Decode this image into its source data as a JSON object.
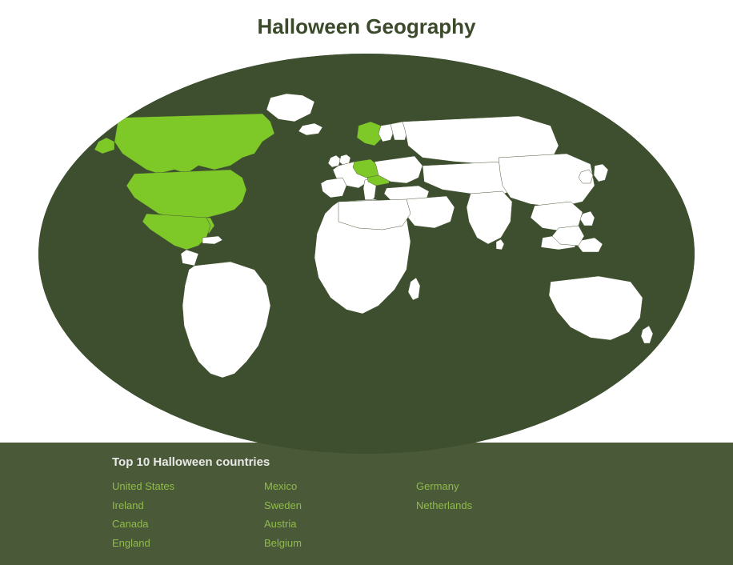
{
  "title": "Halloween Geography",
  "bottom_section": {
    "heading": "Top 10 Halloween countries",
    "columns": [
      [
        "United States",
        "Ireland",
        "Canada",
        "England"
      ],
      [
        "Mexico",
        "Sweden",
        "Austria",
        "Belgium"
      ],
      [
        "Germany",
        "Netherlands"
      ]
    ]
  },
  "colors": {
    "bg_dark": "#3d4f2e",
    "bg_bottom": "#4a5a38",
    "highlight_green": "#7ec828",
    "country_white": "#ffffff",
    "country_outline": "#4a5a38",
    "title_color": "#3a4a2a",
    "country_text": "#8fbc4a"
  }
}
